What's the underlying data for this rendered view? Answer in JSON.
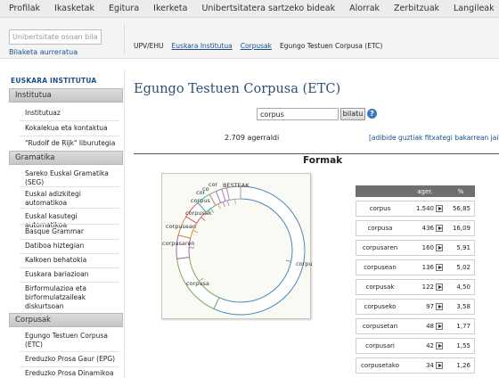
{
  "topnav": [
    "Profilak",
    "Ikasketak",
    "Egitura",
    "Ikerketa",
    "Unibertsitatera sartzeko bideak",
    "Alorrak",
    "Zerbitzuak",
    "Langileak"
  ],
  "search": {
    "placeholder": "Unibertsitate osoan bilat",
    "advanced": "Bilaketa aurreratua"
  },
  "breadcrumb": [
    "UPV/EHU",
    "Euskara Institutua",
    "Corpusak",
    "Egungo Testuen Corpusa (ETC)"
  ],
  "sidebar": {
    "title": "EUSKARA INSTITUTUA",
    "sections": [
      {
        "label": "Institutua",
        "items": [
          "Institutuaz",
          "Kokalekua eta kontaktua",
          "\"Rudolf de Rijk\" liburutegia"
        ]
      },
      {
        "label": "Gramatika",
        "items": [
          "Sareko Euskal Gramatika (SEG)",
          "Euskal adizkitegi automatikoa",
          "Euskal kasutegi automatikoa",
          "Basque Grammar",
          "Datiboa hiztegian",
          "Kalkoen behatokia",
          "Euskara bariazioan",
          "Birformulazioa eta birformulatzaileak diskurtsoan"
        ]
      },
      {
        "label": "Corpusak",
        "items": [
          "Egungo Testuen Corpusa (ETC)",
          "Ereduzko Prosa Gaur (EPG)",
          "Ereduzko Prosa Dinamikoa"
        ]
      }
    ]
  },
  "main": {
    "title": "Egungo Testuen Corpusa (ETC)",
    "query": "corpus",
    "search_button": "bilatu",
    "help_symbol": "?",
    "count": "2.709 agerraldi",
    "all_link": "[adibide guztiak fitxategi bakarrean jaitsi]",
    "forms_title": "Formak"
  },
  "table": {
    "headers": [
      "",
      "ager.",
      "%"
    ],
    "rows": [
      {
        "form": "corpus",
        "count": "1.540",
        "pct": "56,85"
      },
      {
        "form": "corpusa",
        "count": "436",
        "pct": "16,09"
      },
      {
        "form": "corpusaren",
        "count": "160",
        "pct": "5,91"
      },
      {
        "form": "corpusean",
        "count": "136",
        "pct": "5,02"
      },
      {
        "form": "corpusak",
        "count": "122",
        "pct": "4,50"
      },
      {
        "form": "corpuseko",
        "count": "97",
        "pct": "3,58"
      },
      {
        "form": "corpusetan",
        "count": "48",
        "pct": "1,77"
      },
      {
        "form": "corpusari",
        "count": "42",
        "pct": "1,55"
      },
      {
        "form": "corpusetako",
        "count": "34",
        "pct": "1,26"
      }
    ]
  },
  "chart_data": {
    "type": "pie",
    "categories": [
      "corpus",
      "corpusa",
      "corpusaren",
      "corpusean",
      "corpusak",
      "corpuseko",
      "corpusetan",
      "corpusari",
      "corpusetako",
      "BESTEAK"
    ],
    "values": [
      56.85,
      16.09,
      5.91,
      5.02,
      4.5,
      3.58,
      1.77,
      1.55,
      1.26,
      3.47
    ],
    "slice_labels": [
      "corpus",
      "corpusa",
      "corpusaren",
      "corpusean",
      "corpusak",
      "corpus",
      "cor",
      "co",
      "cor",
      "BESTEAK"
    ],
    "colors": [
      "#4a86b8",
      "#7aa85a",
      "#9a6a9e",
      "#d48a3a",
      "#d65a5a",
      "#4aa8a8",
      "#b09a5a",
      "#8a8ac8",
      "#c87aa0",
      "#a0a0a0"
    ]
  }
}
